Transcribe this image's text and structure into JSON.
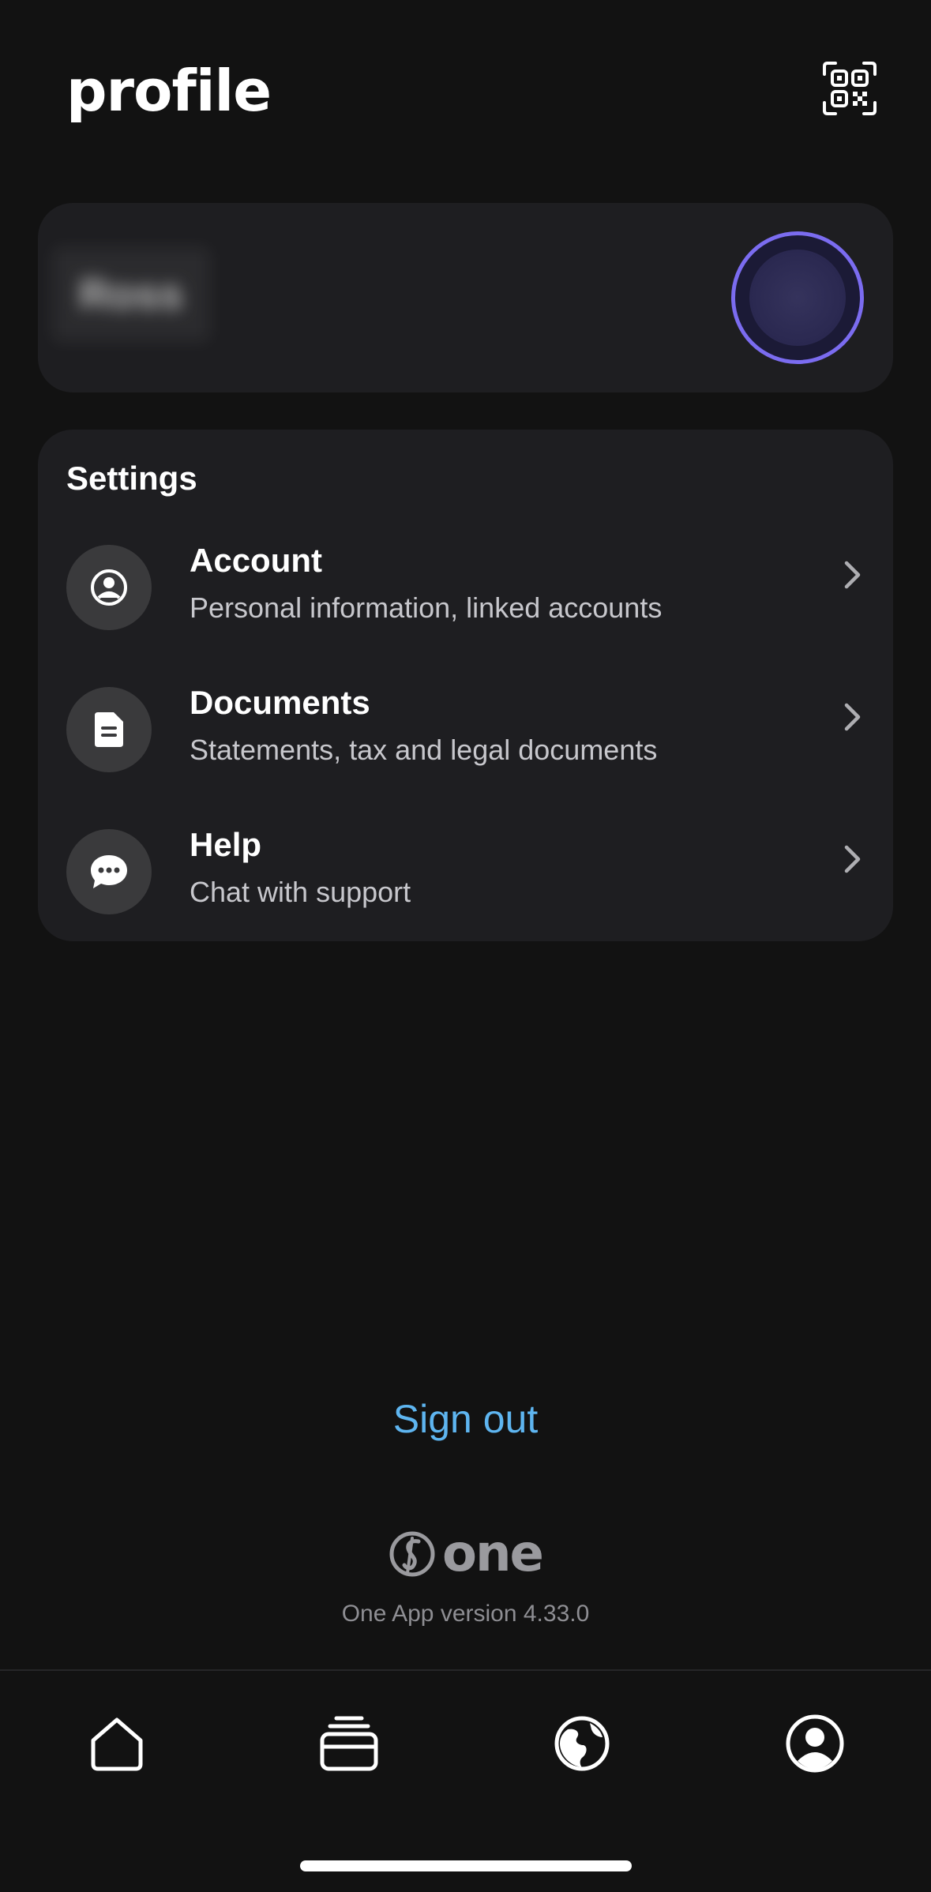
{
  "header": {
    "title": "profile",
    "qr_icon": "qr-code-scan-icon"
  },
  "user_card": {
    "name_blurred": "Ross",
    "avatar_ring_color": "#7b6cf0"
  },
  "settings": {
    "title": "Settings",
    "items": [
      {
        "icon": "user-circle-icon",
        "title": "Account",
        "subtitle": "Personal information, linked accounts"
      },
      {
        "icon": "document-icon",
        "title": "Documents",
        "subtitle": "Statements, tax and legal documents"
      },
      {
        "icon": "chat-bubble-icon",
        "title": "Help",
        "subtitle": "Chat with support"
      }
    ]
  },
  "sign_out": {
    "label": "Sign out",
    "color": "#5eb5f0"
  },
  "brand": {
    "word": "one",
    "version_text": "One App version 4.33.0"
  },
  "tab_bar": {
    "tabs": [
      {
        "icon": "home-icon",
        "active": false
      },
      {
        "icon": "cards-icon",
        "active": false
      },
      {
        "icon": "globe-icon",
        "active": false
      },
      {
        "icon": "profile-icon",
        "active": true
      }
    ]
  }
}
